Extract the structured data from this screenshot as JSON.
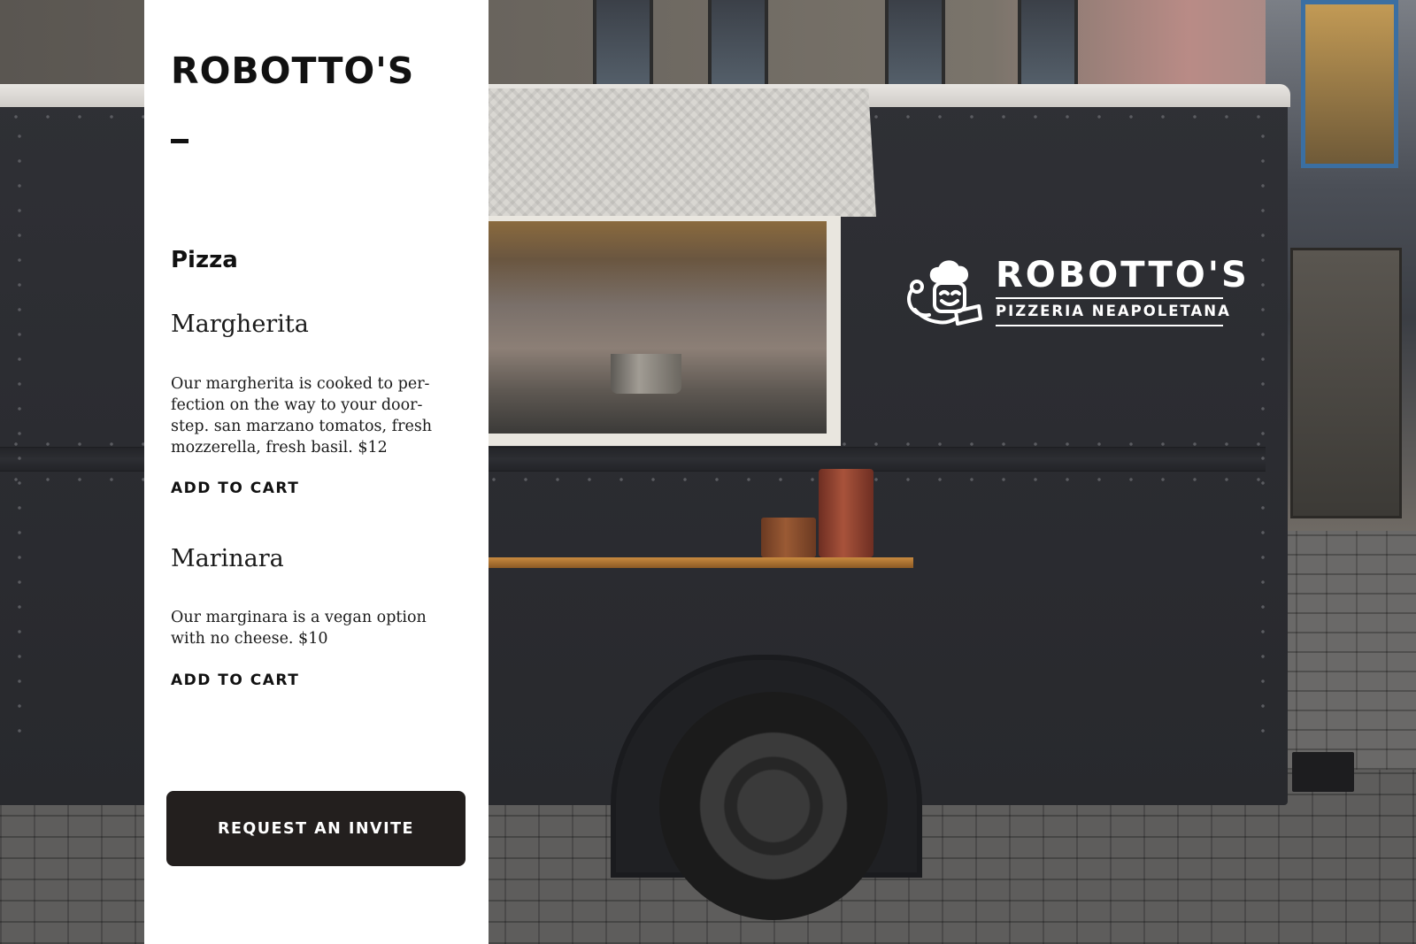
{
  "brand": {
    "name": "ROBOTTO'S"
  },
  "menu": {
    "section_title": "Pizza",
    "items": [
      {
        "name": "Margherita",
        "description": "Our margherita is cooked to per-fection on the way to your door-step. san marzano tomatos, fresh mozzerella, fresh basil. $12",
        "action_label": "ADD TO CART"
      },
      {
        "name": "Marinara",
        "description": "Our marginara is a vegan option with no cheese. $10",
        "action_label": "ADD TO CART"
      }
    ]
  },
  "cta": {
    "label": "REQUEST AN INVITE"
  },
  "truck_logo": {
    "brand": "ROBOTTO'S",
    "tagline": "PIZZERIA NEAPOLETANA",
    "mascot_icon": "chef-robot-mascot-icon"
  },
  "colors": {
    "panel_background": "#ffffff",
    "text_primary": "#111111",
    "button_background": "#231f1e",
    "button_text": "#ffffff",
    "truck_body": "#2b2c31"
  }
}
